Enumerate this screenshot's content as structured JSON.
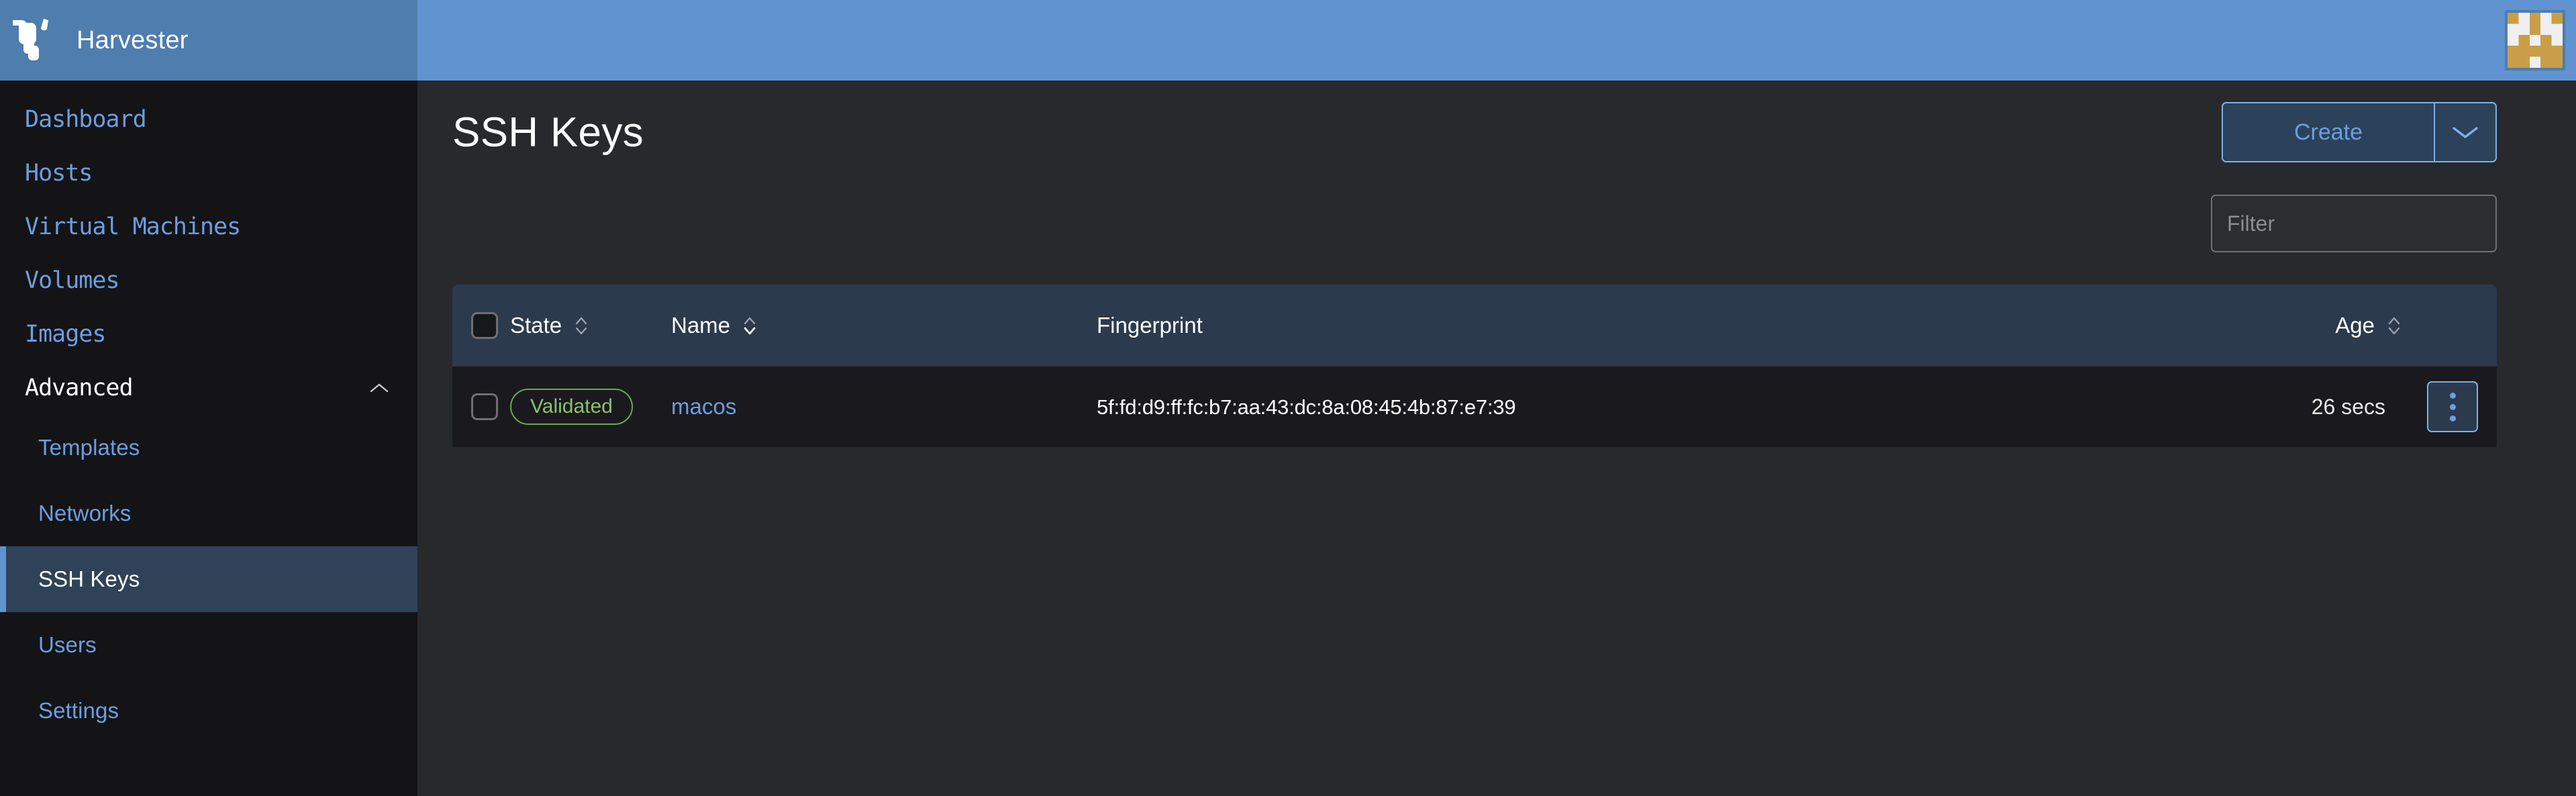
{
  "brand": {
    "name": "Harvester",
    "logo_icon": "harvester-bull-logo"
  },
  "colors": {
    "header_blue": "#6093d0",
    "sidebar_header_blue": "#4f7dae",
    "sidebar_bg": "#141417",
    "main_bg": "#27292d",
    "table_header_bg": "#2b3a4d",
    "table_row_bg": "#1a1a1e",
    "link_blue": "#6c9ee0",
    "accent_border_blue": "#7eb0e8",
    "validated_green": "#8cc26c",
    "avatar_gold": "#ca9e49",
    "avatar_light": "#efefef"
  },
  "sidebar": {
    "items": [
      {
        "label": "Dashboard",
        "type": "link",
        "active": false
      },
      {
        "label": "Hosts",
        "type": "link",
        "active": false
      },
      {
        "label": "Virtual Machines",
        "type": "link",
        "active": false
      },
      {
        "label": "Volumes",
        "type": "link",
        "active": false
      },
      {
        "label": "Images",
        "type": "link",
        "active": false
      }
    ],
    "group": {
      "label": "Advanced",
      "expanded": true,
      "toggle_icon": "chevron-up-icon",
      "items": [
        {
          "label": "Templates",
          "active": false
        },
        {
          "label": "Networks",
          "active": false
        },
        {
          "label": "SSH Keys",
          "active": true
        },
        {
          "label": "Users",
          "active": false
        },
        {
          "label": "Settings",
          "active": false
        }
      ]
    }
  },
  "header": {
    "avatar_icon": "user-identicon-avatar",
    "avatar_grid": [
      [
        1,
        0,
        1,
        0,
        1
      ],
      [
        0,
        0,
        1,
        0,
        0
      ],
      [
        0,
        1,
        0,
        1,
        0
      ],
      [
        1,
        1,
        1,
        1,
        1
      ],
      [
        1,
        1,
        0,
        1,
        1
      ]
    ]
  },
  "page": {
    "title": "SSH Keys",
    "create_label": "Create",
    "create_dropdown_icon": "chevron-down-icon"
  },
  "filter": {
    "value": "",
    "placeholder": "Filter"
  },
  "table": {
    "columns": [
      {
        "key": "state",
        "label": "State",
        "sortable": true,
        "sort_icon": "sort-arrows-icon",
        "sort_state": "none"
      },
      {
        "key": "name",
        "label": "Name",
        "sortable": true,
        "sort_icon": "sort-arrows-icon",
        "sort_state": "asc"
      },
      {
        "key": "fingerprint",
        "label": "Fingerprint",
        "sortable": false
      },
      {
        "key": "age",
        "label": "Age",
        "sortable": true,
        "sort_icon": "sort-arrows-icon",
        "sort_state": "none"
      }
    ],
    "select_all_checked": false,
    "rows": [
      {
        "checked": false,
        "state": "Validated",
        "name": "macos",
        "fingerprint": "5f:fd:d9:ff:fc:b7:aa:43:dc:8a:08:45:4b:87:e7:39",
        "age": "26 secs",
        "actions_icon": "kebab-menu-icon"
      }
    ]
  }
}
